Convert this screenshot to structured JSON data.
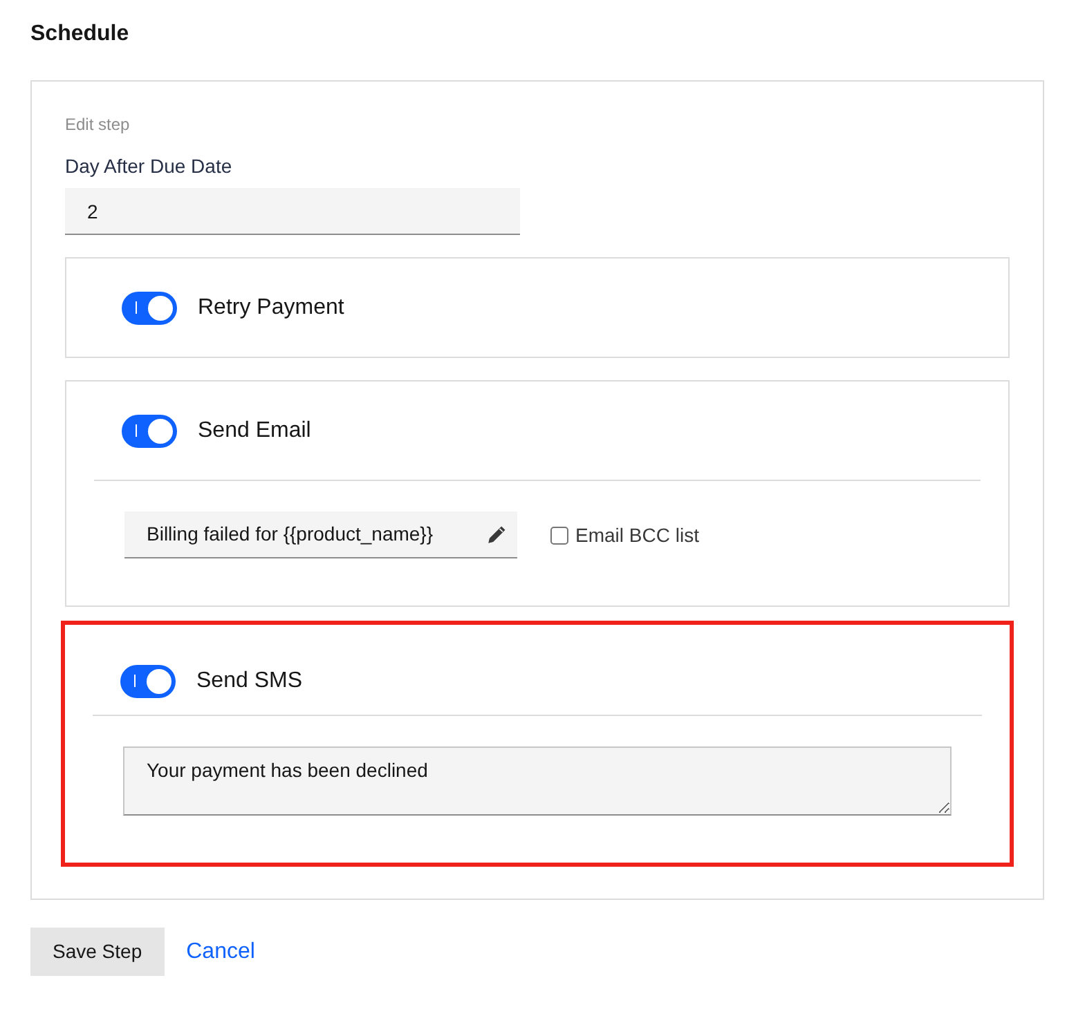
{
  "page_title": "Schedule",
  "form": {
    "caption": "Edit step",
    "day_label": "Day After Due Date",
    "day_value": "2"
  },
  "sections": [
    {
      "kind": "toggle",
      "label": "Retry Payment",
      "on": true,
      "highlighted": false
    },
    {
      "kind": "email",
      "label": "Send Email",
      "on": true,
      "highlighted": false,
      "subject": "Billing failed for {{product_name}}",
      "bcc_label": "Email BCC list",
      "bcc_checked": false
    },
    {
      "kind": "sms",
      "label": "Send SMS",
      "on": true,
      "highlighted": true,
      "message": "Your payment has been declined"
    }
  ],
  "buttons": {
    "save": "Save Step",
    "cancel": "Cancel"
  }
}
